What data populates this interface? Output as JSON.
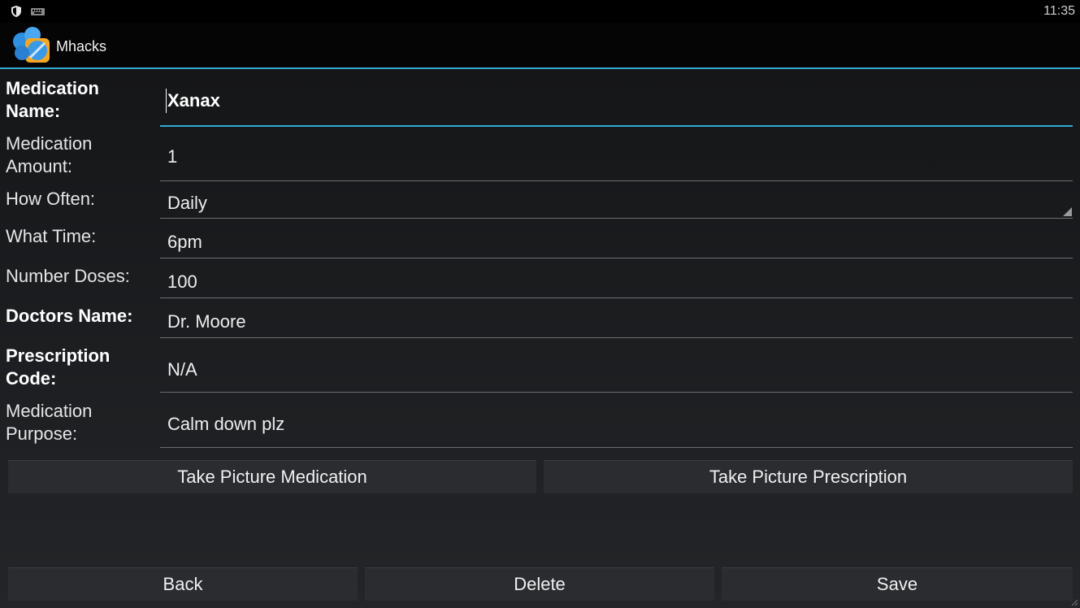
{
  "status_bar": {
    "time": "11:35",
    "icons": [
      "shield-icon",
      "keyboard-icon"
    ]
  },
  "action_bar": {
    "title": "Mhacks",
    "app_icon": "pill-icon",
    "accent_color": "#33a9d6"
  },
  "form": {
    "medication_name": {
      "label": "Medication Name:",
      "value": "Xanax"
    },
    "medication_amount": {
      "label": "Medication Amount:",
      "value": "1"
    },
    "how_often": {
      "label": "How Often:",
      "value": "Daily"
    },
    "what_time": {
      "label": "What Time:",
      "value": "6pm"
    },
    "number_doses": {
      "label": "Number Doses:",
      "value": "100"
    },
    "doctors_name": {
      "label": "Doctors Name:",
      "value": "Dr. Moore"
    },
    "prescription_code": {
      "label": "Prescription Code:",
      "value": "N/A"
    },
    "medication_purpose": {
      "label": "Medication Purpose:",
      "value": "Calm down plz"
    }
  },
  "buttons": {
    "take_picture_medication": "Take Picture Medication",
    "take_picture_prescription": "Take Picture Prescription",
    "back": "Back",
    "delete": "Delete",
    "save": "Save"
  }
}
